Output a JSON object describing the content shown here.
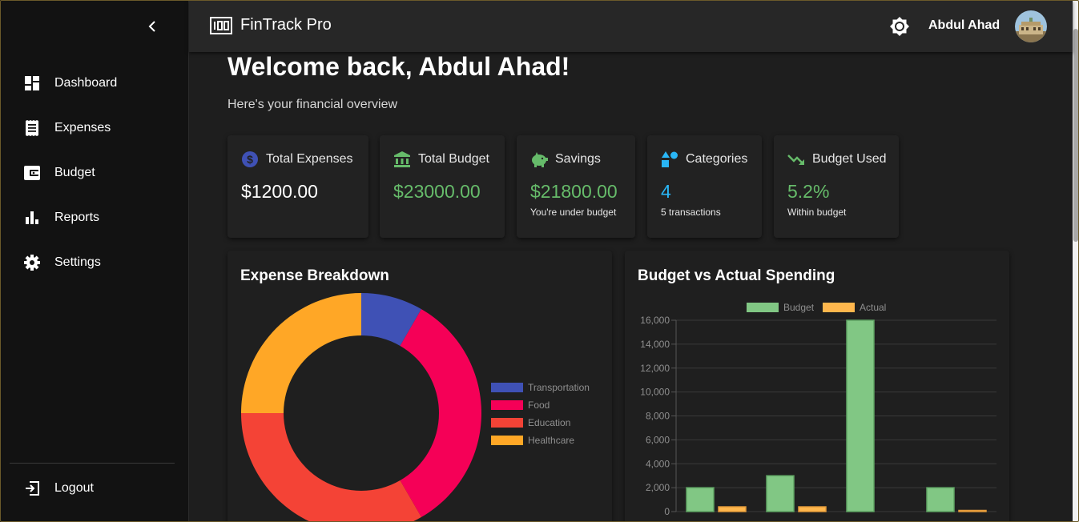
{
  "sidebar": {
    "items": [
      {
        "label": "Dashboard",
        "icon": "dashboard-icon"
      },
      {
        "label": "Expenses",
        "icon": "receipt-icon"
      },
      {
        "label": "Budget",
        "icon": "wallet-icon"
      },
      {
        "label": "Reports",
        "icon": "bar-chart-icon"
      },
      {
        "label": "Settings",
        "icon": "gear-icon"
      }
    ],
    "logout_label": "Logout"
  },
  "header": {
    "brand": "FinTrack Pro",
    "user_name": "Abdul Ahad"
  },
  "main": {
    "welcome": "Welcome back, Abdul Ahad!",
    "subtitle": "Here's your financial overview"
  },
  "cards": [
    {
      "title": "Total Expenses",
      "value": "$1200.00",
      "sub": "",
      "icon": "dollar-icon",
      "color": "#ffffff",
      "icon_color": "#3f51b5"
    },
    {
      "title": "Total Budget",
      "value": "$23000.00",
      "sub": "",
      "icon": "bank-icon",
      "color": "#66bb6a",
      "icon_color": "#66bb6a"
    },
    {
      "title": "Savings",
      "value": "$21800.00",
      "sub": "You're under budget",
      "icon": "piggy-bank-icon",
      "color": "#66bb6a",
      "icon_color": "#66bb6a"
    },
    {
      "title": "Categories",
      "value": "4",
      "sub": "5 transactions",
      "icon": "categories-icon",
      "color": "#29b6f6",
      "icon_color": "#29b6f6"
    },
    {
      "title": "Budget Used",
      "value": "5.2%",
      "sub": "Within budget",
      "icon": "trending-down-icon",
      "color": "#66bb6a",
      "icon_color": "#66bb6a"
    }
  ],
  "expense_panel": {
    "title": "Expense Breakdown"
  },
  "budget_panel": {
    "title": "Budget vs Actual Spending"
  },
  "chart_data": [
    {
      "type": "pie",
      "title": "Expense Breakdown",
      "categories": [
        "Transportation",
        "Food",
        "Education",
        "Healthcare"
      ],
      "values": [
        100,
        400,
        400,
        300
      ],
      "colors": [
        "#3f51b5",
        "#f50057",
        "#f44336",
        "#ffa726"
      ],
      "legend": "right"
    },
    {
      "type": "bar",
      "title": "Budget vs Actual Spending",
      "categories": [
        "",
        "",
        "",
        ""
      ],
      "series": [
        {
          "name": "Budget",
          "values": [
            2000,
            3000,
            16000,
            2000
          ],
          "color": "#81c784"
        },
        {
          "name": "Actual",
          "values": [
            400,
            400,
            0,
            100
          ],
          "color": "#ffb74d"
        }
      ],
      "ylim": [
        0,
        16000
      ],
      "yticks": [
        "16,000",
        "14,000",
        "12,000",
        "10,000",
        "8,000",
        "6,000",
        "4,000",
        "2,000",
        "0"
      ],
      "grid": true,
      "legend": "top"
    }
  ]
}
